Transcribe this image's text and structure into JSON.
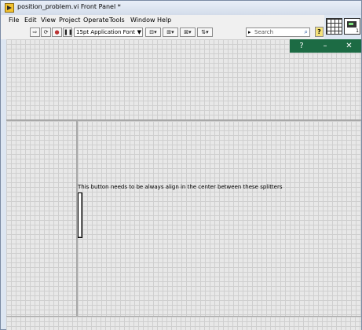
{
  "window": {
    "title": "position_problem.vi Front Panel *"
  },
  "menu": [
    "File",
    "Edit",
    "View",
    "Project",
    "Operate",
    "Tools",
    "Window",
    "Help"
  ],
  "toolbar": {
    "font": "15pt Application Font",
    "search_placeholder": "Search",
    "help_label": "?"
  },
  "window_controls": {
    "help": "?",
    "minimize": "–",
    "close": "✕"
  },
  "panel": {
    "message": "This button needs to be always align in the center between these splitters"
  },
  "icons": {
    "vi_icon_number": "1"
  },
  "colors": {
    "control_bar": "#1c6b44",
    "grid": "#cfcfcf"
  }
}
